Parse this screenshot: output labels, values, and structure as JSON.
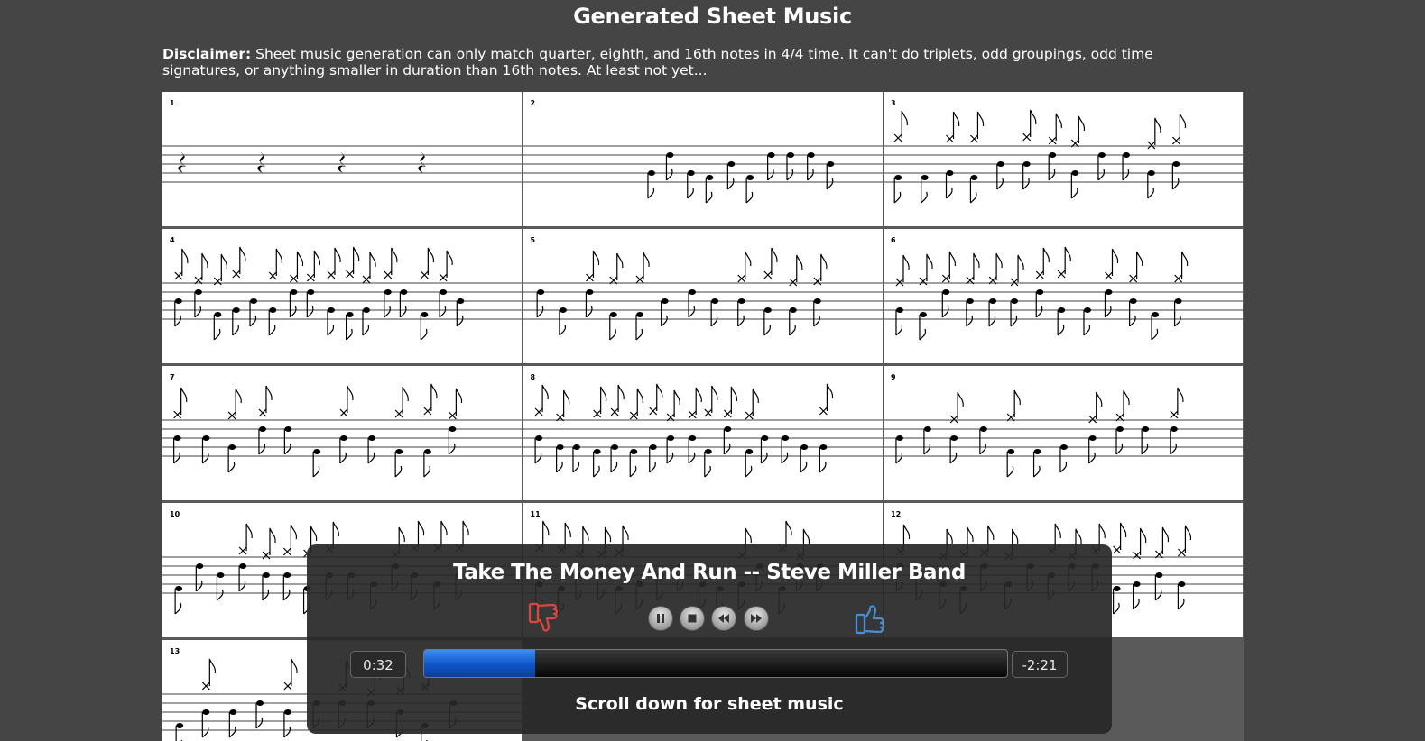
{
  "page": {
    "title": "Generated Sheet Music",
    "disclaimer_label": "Disclaimer:",
    "disclaimer_text": " Sheet music generation can only match quarter, eighth, and 16th notes in 4/4 time. It can't do triplets, odd groupings, odd time signatures, or anything smaller in duration than 16th notes. At least not yet..."
  },
  "sheet": {
    "measure_numbers": [
      "1",
      "2",
      "3",
      "4",
      "5",
      "6",
      "7",
      "8",
      "9",
      "10",
      "11",
      "12",
      "13"
    ]
  },
  "player": {
    "song_title": "Take The Money And Run -- Steve Miller Band",
    "elapsed": "0:32",
    "remaining": "-2:21",
    "progress_fraction": 0.19,
    "scroll_hint": "Scroll down for sheet music",
    "dislike_color": "#e0443c",
    "like_color": "#4a8fd6",
    "controls": [
      "pause-icon",
      "stop-icon",
      "rewind-icon",
      "fast-forward-icon"
    ]
  }
}
